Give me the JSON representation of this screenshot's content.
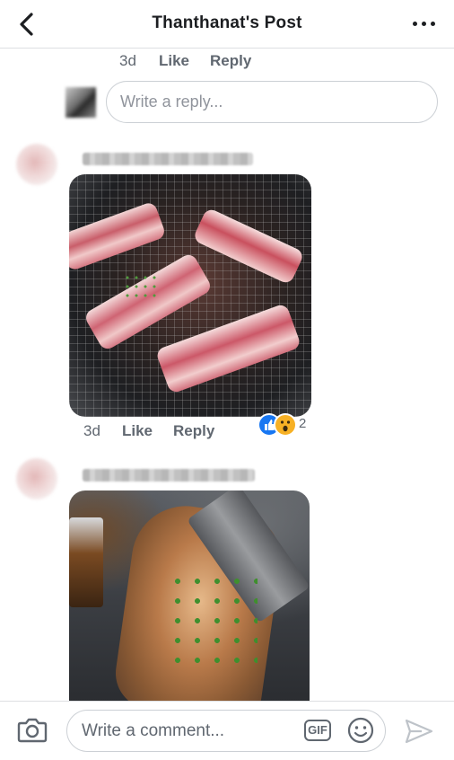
{
  "header": {
    "title": "Thanthanat's Post",
    "back_icon": "chevron-left-icon",
    "more_icon": "more-horizontal-icon"
  },
  "first_comment_actions": {
    "time": "3d",
    "like_label": "Like",
    "reply_label": "Reply"
  },
  "reply_box": {
    "placeholder": "Write a reply..."
  },
  "comments": [
    {
      "time": "3d",
      "like_label": "Like",
      "reply_label": "Reply",
      "reactions": {
        "icons": [
          "like-icon",
          "wow-icon"
        ],
        "count": "2"
      }
    },
    {}
  ],
  "composer": {
    "placeholder": "Write a comment...",
    "gif_label": "GIF",
    "camera_icon": "camera-icon",
    "emoji_icon": "emoji-icon",
    "send_icon": "send-icon"
  },
  "colors": {
    "text_primary": "#1c1e21",
    "text_secondary": "#606770",
    "border": "#ccd0d5",
    "like_blue": "#1877f2",
    "wow_yellow": "#f7b125"
  }
}
